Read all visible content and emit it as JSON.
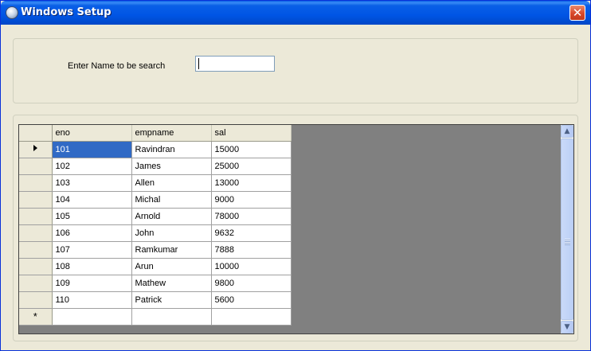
{
  "window": {
    "title": "Windows Setup",
    "close_glyph": "✕",
    "icon": "app-globe-icon"
  },
  "search": {
    "label": "Enter Name to  be search",
    "value": "",
    "placeholder": ""
  },
  "grid": {
    "columns": [
      "eno",
      "empname",
      "sal"
    ],
    "rows": [
      [
        "101",
        "Ravindran",
        "15000"
      ],
      [
        "102",
        "James",
        "25000"
      ],
      [
        "103",
        "Allen",
        "13000"
      ],
      [
        "104",
        "Michal",
        "9000"
      ],
      [
        "105",
        "Arnold",
        "78000"
      ],
      [
        "106",
        "John",
        "9632"
      ],
      [
        "107",
        "Ramkumar",
        "7888"
      ],
      [
        "108",
        "Arun",
        "10000"
      ],
      [
        "109",
        "Mathew",
        "9800"
      ],
      [
        "110",
        "Patrick",
        "5600"
      ]
    ],
    "new_row_marker": "*",
    "current_row_marker": "arrow-right-icon",
    "selected_row": 0,
    "selected_col": 0
  },
  "scrollbar": {
    "up_glyph": "▲",
    "down_glyph": "▼"
  },
  "colors": {
    "titlebar": "#0055e5",
    "selection": "#316ac5",
    "grid_background": "#808080",
    "window_face": "#ece9d8"
  }
}
